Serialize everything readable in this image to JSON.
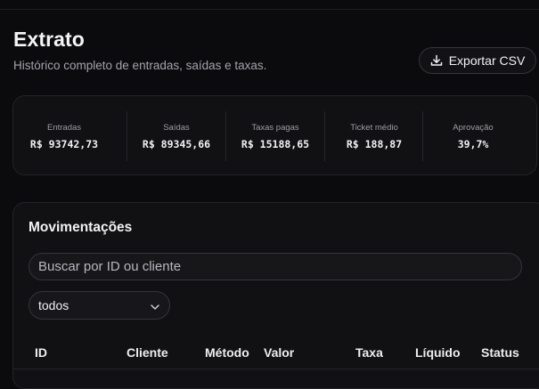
{
  "header": {
    "title": "Extrato",
    "subtitle": "Histórico completo de entradas, saídas e taxas.",
    "export_label": "Exportar CSV"
  },
  "stats": [
    {
      "label": "Entradas",
      "value": "R$ 93742,73"
    },
    {
      "label": "Saídas",
      "value": "R$ 89345,66"
    },
    {
      "label": "Taxas pagas",
      "value": "R$ 15188,65"
    },
    {
      "label": "Ticket médio",
      "value": "R$ 188,87"
    },
    {
      "label": "Aprovação",
      "value": "39,7%"
    }
  ],
  "movements": {
    "title": "Movimentações",
    "search_placeholder": "Buscar por ID ou cliente",
    "filter_value": "todos",
    "columns": [
      "ID",
      "Cliente",
      "Método",
      "Valor",
      "Taxa",
      "Líquido",
      "Status"
    ]
  },
  "icons": {
    "export": "download-icon",
    "filter": "chevron-down-icon"
  },
  "colors": {
    "background": "#0b0b0d",
    "card": "#111114",
    "border": "#232328",
    "text_muted": "#a3a3aa"
  }
}
